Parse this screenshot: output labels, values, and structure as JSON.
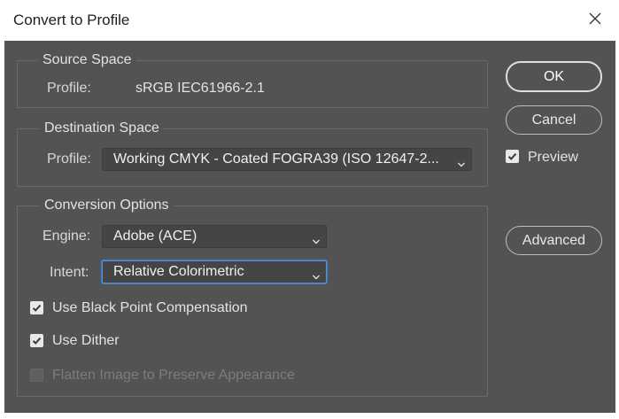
{
  "window": {
    "title": "Convert to Profile"
  },
  "source_space": {
    "legend": "Source Space",
    "profile_label": "Profile:",
    "profile_value": "sRGB IEC61966-2.1"
  },
  "destination_space": {
    "legend": "Destination Space",
    "profile_label": "Profile:",
    "profile_value": "Working CMYK - Coated FOGRA39 (ISO 12647-2..."
  },
  "conversion_options": {
    "legend": "Conversion Options",
    "engine_label": "Engine:",
    "engine_value": "Adobe (ACE)",
    "intent_label": "Intent:",
    "intent_value": "Relative Colorimetric",
    "black_point_label": "Use Black Point Compensation",
    "dither_label": "Use Dither",
    "flatten_label": "Flatten Image to Preserve Appearance"
  },
  "buttons": {
    "ok": "OK",
    "cancel": "Cancel",
    "preview": "Preview",
    "advanced": "Advanced"
  },
  "state": {
    "black_point_checked": true,
    "dither_checked": true,
    "flatten_checked": false,
    "flatten_enabled": false,
    "preview_checked": true
  },
  "icons": {
    "close": "close-icon",
    "chevron": "chevron-down-icon",
    "check": "check-icon"
  },
  "colors": {
    "panel_bg": "#535353",
    "select_bg": "#454545",
    "focus": "#4f8fd6"
  }
}
